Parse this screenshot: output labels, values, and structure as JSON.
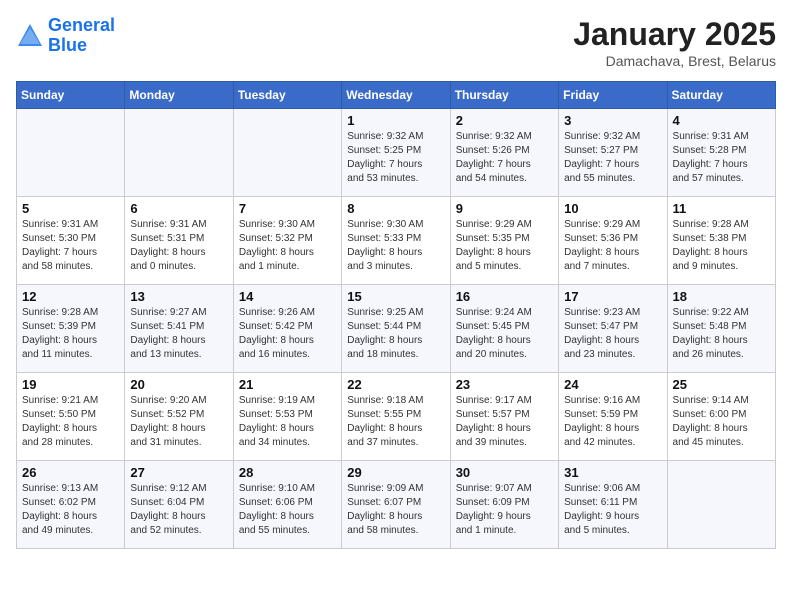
{
  "header": {
    "logo_line1": "General",
    "logo_line2": "Blue",
    "month": "January 2025",
    "location": "Damachava, Brest, Belarus"
  },
  "weekdays": [
    "Sunday",
    "Monday",
    "Tuesday",
    "Wednesday",
    "Thursday",
    "Friday",
    "Saturday"
  ],
  "weeks": [
    [
      {
        "day": "",
        "info": ""
      },
      {
        "day": "",
        "info": ""
      },
      {
        "day": "",
        "info": ""
      },
      {
        "day": "1",
        "info": "Sunrise: 9:32 AM\nSunset: 5:25 PM\nDaylight: 7 hours\nand 53 minutes."
      },
      {
        "day": "2",
        "info": "Sunrise: 9:32 AM\nSunset: 5:26 PM\nDaylight: 7 hours\nand 54 minutes."
      },
      {
        "day": "3",
        "info": "Sunrise: 9:32 AM\nSunset: 5:27 PM\nDaylight: 7 hours\nand 55 minutes."
      },
      {
        "day": "4",
        "info": "Sunrise: 9:31 AM\nSunset: 5:28 PM\nDaylight: 7 hours\nand 57 minutes."
      }
    ],
    [
      {
        "day": "5",
        "info": "Sunrise: 9:31 AM\nSunset: 5:30 PM\nDaylight: 7 hours\nand 58 minutes."
      },
      {
        "day": "6",
        "info": "Sunrise: 9:31 AM\nSunset: 5:31 PM\nDaylight: 8 hours\nand 0 minutes."
      },
      {
        "day": "7",
        "info": "Sunrise: 9:30 AM\nSunset: 5:32 PM\nDaylight: 8 hours\nand 1 minute."
      },
      {
        "day": "8",
        "info": "Sunrise: 9:30 AM\nSunset: 5:33 PM\nDaylight: 8 hours\nand 3 minutes."
      },
      {
        "day": "9",
        "info": "Sunrise: 9:29 AM\nSunset: 5:35 PM\nDaylight: 8 hours\nand 5 minutes."
      },
      {
        "day": "10",
        "info": "Sunrise: 9:29 AM\nSunset: 5:36 PM\nDaylight: 8 hours\nand 7 minutes."
      },
      {
        "day": "11",
        "info": "Sunrise: 9:28 AM\nSunset: 5:38 PM\nDaylight: 8 hours\nand 9 minutes."
      }
    ],
    [
      {
        "day": "12",
        "info": "Sunrise: 9:28 AM\nSunset: 5:39 PM\nDaylight: 8 hours\nand 11 minutes."
      },
      {
        "day": "13",
        "info": "Sunrise: 9:27 AM\nSunset: 5:41 PM\nDaylight: 8 hours\nand 13 minutes."
      },
      {
        "day": "14",
        "info": "Sunrise: 9:26 AM\nSunset: 5:42 PM\nDaylight: 8 hours\nand 16 minutes."
      },
      {
        "day": "15",
        "info": "Sunrise: 9:25 AM\nSunset: 5:44 PM\nDaylight: 8 hours\nand 18 minutes."
      },
      {
        "day": "16",
        "info": "Sunrise: 9:24 AM\nSunset: 5:45 PM\nDaylight: 8 hours\nand 20 minutes."
      },
      {
        "day": "17",
        "info": "Sunrise: 9:23 AM\nSunset: 5:47 PM\nDaylight: 8 hours\nand 23 minutes."
      },
      {
        "day": "18",
        "info": "Sunrise: 9:22 AM\nSunset: 5:48 PM\nDaylight: 8 hours\nand 26 minutes."
      }
    ],
    [
      {
        "day": "19",
        "info": "Sunrise: 9:21 AM\nSunset: 5:50 PM\nDaylight: 8 hours\nand 28 minutes."
      },
      {
        "day": "20",
        "info": "Sunrise: 9:20 AM\nSunset: 5:52 PM\nDaylight: 8 hours\nand 31 minutes."
      },
      {
        "day": "21",
        "info": "Sunrise: 9:19 AM\nSunset: 5:53 PM\nDaylight: 8 hours\nand 34 minutes."
      },
      {
        "day": "22",
        "info": "Sunrise: 9:18 AM\nSunset: 5:55 PM\nDaylight: 8 hours\nand 37 minutes."
      },
      {
        "day": "23",
        "info": "Sunrise: 9:17 AM\nSunset: 5:57 PM\nDaylight: 8 hours\nand 39 minutes."
      },
      {
        "day": "24",
        "info": "Sunrise: 9:16 AM\nSunset: 5:59 PM\nDaylight: 8 hours\nand 42 minutes."
      },
      {
        "day": "25",
        "info": "Sunrise: 9:14 AM\nSunset: 6:00 PM\nDaylight: 8 hours\nand 45 minutes."
      }
    ],
    [
      {
        "day": "26",
        "info": "Sunrise: 9:13 AM\nSunset: 6:02 PM\nDaylight: 8 hours\nand 49 minutes."
      },
      {
        "day": "27",
        "info": "Sunrise: 9:12 AM\nSunset: 6:04 PM\nDaylight: 8 hours\nand 52 minutes."
      },
      {
        "day": "28",
        "info": "Sunrise: 9:10 AM\nSunset: 6:06 PM\nDaylight: 8 hours\nand 55 minutes."
      },
      {
        "day": "29",
        "info": "Sunrise: 9:09 AM\nSunset: 6:07 PM\nDaylight: 8 hours\nand 58 minutes."
      },
      {
        "day": "30",
        "info": "Sunrise: 9:07 AM\nSunset: 6:09 PM\nDaylight: 9 hours\nand 1 minute."
      },
      {
        "day": "31",
        "info": "Sunrise: 9:06 AM\nSunset: 6:11 PM\nDaylight: 9 hours\nand 5 minutes."
      },
      {
        "day": "",
        "info": ""
      }
    ]
  ]
}
